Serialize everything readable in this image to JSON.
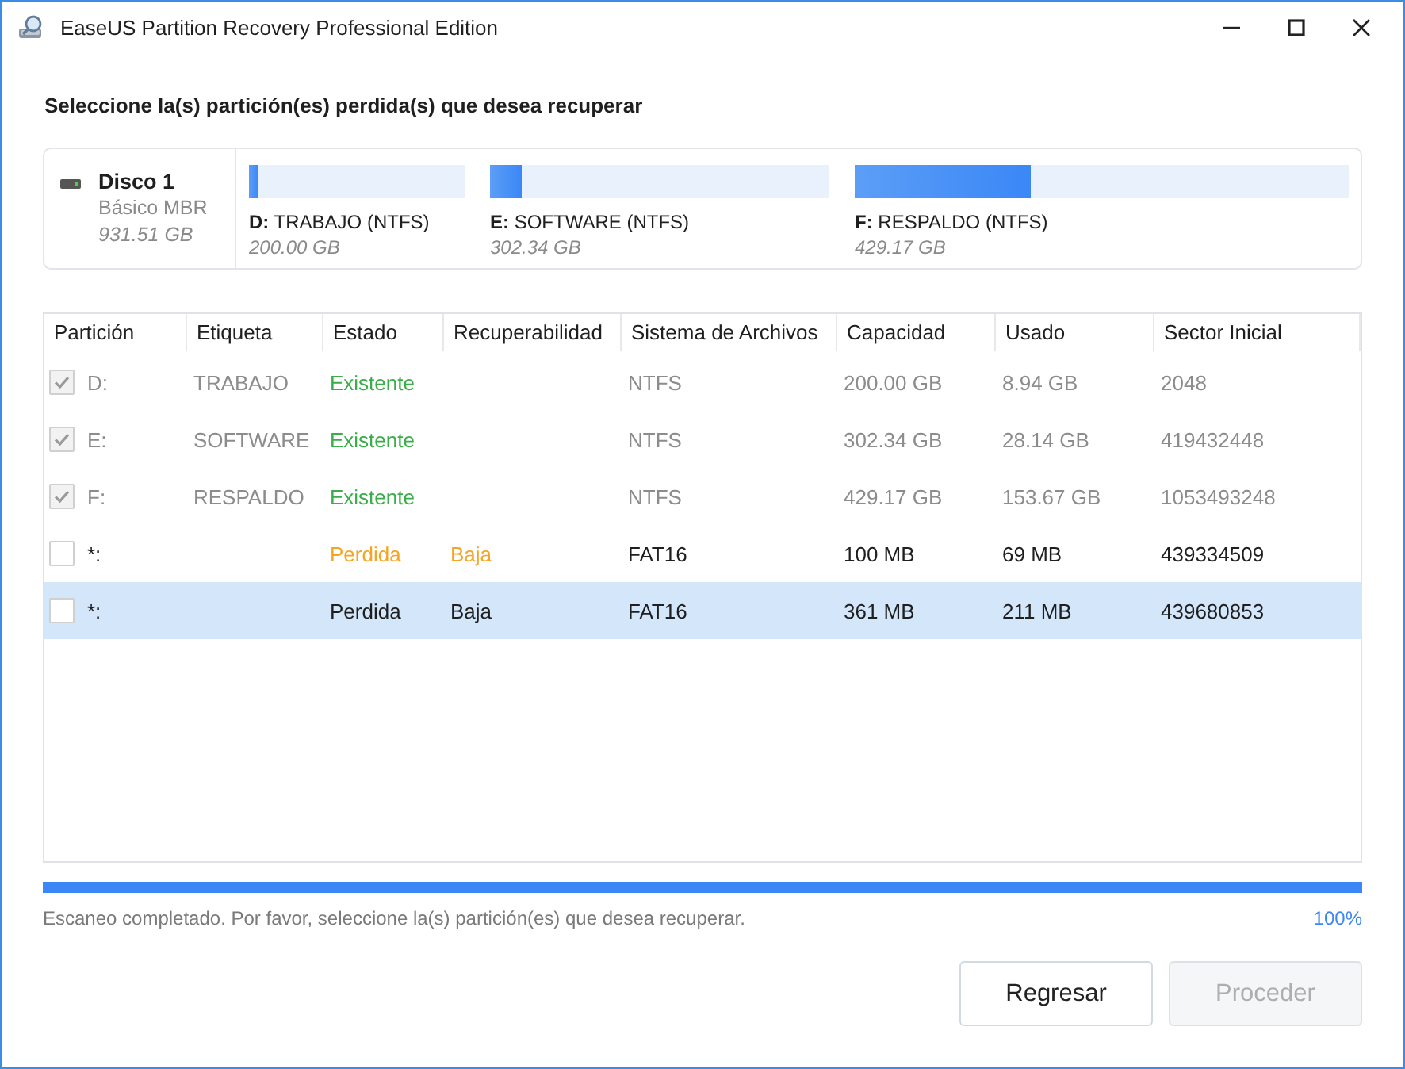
{
  "window": {
    "title": "EaseUS Partition Recovery Professional Edition"
  },
  "heading": "Seleccione la(s) partición(es) perdida(s) que desea recuperar",
  "disk": {
    "name": "Disco 1",
    "type": "Básico MBR",
    "size": "931.51 GB",
    "partitions": [
      {
        "label": "**D:** TRABAJO (NTFS)",
        "size": "200.00 GB",
        "level": 0.045
      },
      {
        "label": "**E:** SOFTWARE (NTFS)",
        "size": "302.34 GB",
        "level": 0.093
      },
      {
        "label": "**F:** RESPALDO (NTFS)",
        "size": "429.17 GB",
        "level": 0.357
      }
    ]
  },
  "table": {
    "columns": [
      "Partición",
      "Etiqueta",
      "Estado",
      "Recuperabilidad",
      "Sistema de Archivos",
      "Capacidad",
      "Usado",
      "Sector Inicial"
    ],
    "rows": [
      {
        "selected": false,
        "checked": true,
        "disabled": true,
        "kind": "existing",
        "partition": "D:",
        "label": "TRABAJO",
        "status": "Existente",
        "file_system": "NTFS",
        "capacity": "200.00 GB",
        "used": "8.94 GB",
        "start_sector": "2048"
      },
      {
        "selected": false,
        "checked": true,
        "disabled": true,
        "kind": "existing",
        "partition": "E:",
        "label": "SOFTWARE",
        "status": "Existente",
        "file_system": "NTFS",
        "capacity": "302.34 GB",
        "used": "28.14 GB",
        "start_sector": "419432448"
      },
      {
        "selected": false,
        "checked": true,
        "disabled": true,
        "kind": "existing",
        "partition": "F:",
        "label": "RESPALDO",
        "status": "Existente",
        "file_system": "NTFS",
        "capacity": "429.17 GB",
        "used": "153.67 GB",
        "start_sector": "1053493248"
      },
      {
        "selected": false,
        "checked": false,
        "disabled": false,
        "kind": "lost",
        "partition": "*:",
        "status": "Perdida",
        "recoverability": "Baja",
        "file_system": "FAT16",
        "capacity": "100 MB",
        "used": "69 MB",
        "start_sector": "439334509"
      },
      {
        "selected": true,
        "checked": false,
        "disabled": false,
        "partition": "*:",
        "status": "Perdida",
        "recoverability": "Baja",
        "file_system": "FAT16",
        "capacity": "361 MB",
        "used": "211 MB",
        "start_sector": "439680853"
      }
    ]
  },
  "progress": {
    "level": 1,
    "message": "Escaneo completado. Por favor, seleccione la(s) partición(es) que desea recuperar.",
    "percent": "100%"
  },
  "buttons": [
    {
      "label": "Regresar",
      "disabled": false
    },
    {
      "label": "Proceder",
      "disabled": true
    }
  ]
}
